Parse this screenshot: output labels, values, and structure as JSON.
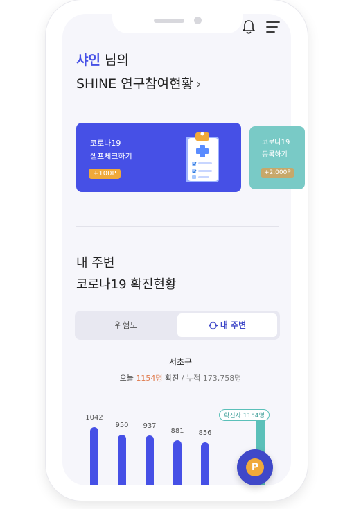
{
  "header": {
    "greeting_name": "샤인",
    "greeting_suffix": " 님의",
    "title": "SHINE 연구참여현황",
    "title_chevron": "›",
    "icons": [
      "bell-icon",
      "menu-icon"
    ]
  },
  "cards": [
    {
      "line1": "코로나19",
      "line2": "셀프체크하기",
      "badge": "+100P",
      "icon": "clipboard-check-icon",
      "color": "#4650e6"
    },
    {
      "line1": "코로나19",
      "line2": "등록하기",
      "badge": "+2,000P",
      "color": "#79cac6"
    }
  ],
  "section": {
    "title_line1": "내 주변",
    "title_line2": "코로나19 확진현황"
  },
  "segment": {
    "option1": "위험도",
    "option2": "내 주변",
    "selected": "내 주변",
    "option2_icon": "crosshair-icon"
  },
  "summary": {
    "district": "서초구",
    "today_prefix": "오늘 ",
    "today_count": "1154명",
    "today_suffix": " 확진",
    "cumulative": " / 누적 173,758명"
  },
  "chart_data": {
    "type": "bar",
    "values": [
      1042,
      950,
      937,
      881,
      856
    ],
    "value_labels": [
      "1042",
      "950",
      "937",
      "881",
      "856"
    ],
    "highlight_label": "확진자 1154명",
    "highlight_value": 1154
  },
  "fab": {
    "label": "P",
    "icon": "points-icon"
  },
  "colors": {
    "accent": "#4650e6",
    "teal": "#5bc0b9",
    "orange": "#f0a93a",
    "highlight_text": "#e07a4c"
  }
}
